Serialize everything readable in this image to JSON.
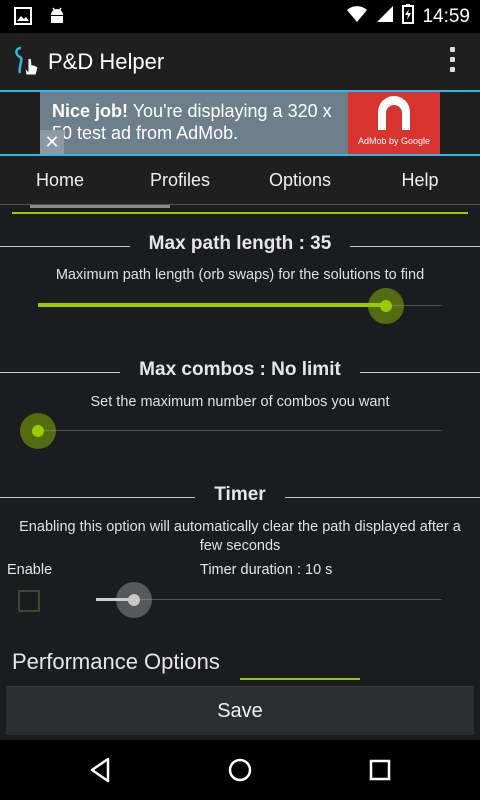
{
  "status_bar": {
    "time": "14:59",
    "left_icons": [
      "image-icon",
      "android-icon"
    ],
    "right_icons": [
      "wifi-icon",
      "signal-icon",
      "battery-icon"
    ]
  },
  "app_bar": {
    "title": "P&D Helper",
    "icon": "app-logo-icon",
    "menu_icon": "overflow-menu-icon"
  },
  "ad": {
    "bold_text": "Nice job!",
    "text": " You're displaying a 320 x 50 test ad from AdMob.",
    "logo_caption": "AdMob by Google",
    "close_symbol": "✕"
  },
  "tabs": [
    {
      "label": "Home"
    },
    {
      "label": "Profiles"
    },
    {
      "label": "Options"
    },
    {
      "label": "Help"
    }
  ],
  "settings": {
    "max_path": {
      "title": "Max path length : 35",
      "description": "Maximum path length (orb swaps) for the solutions to find",
      "value_fraction": 0.87
    },
    "max_combos": {
      "title": "Max combos : No limit",
      "description": "Set the maximum number of combos you want",
      "value_fraction": 0.0
    },
    "timer": {
      "title": "Timer",
      "description": "Enabling this option will automatically clear the path displayed after a few seconds",
      "enable_label": "Enable",
      "enabled": false,
      "duration_label": "Timer duration : 10 s",
      "value_fraction": 0.12
    },
    "performance_title": "Performance Options"
  },
  "save_button": {
    "label": "Save"
  },
  "nav_bar": {
    "icons": [
      "back-icon",
      "home-icon",
      "recents-icon"
    ]
  },
  "colors": {
    "accent_green": "#99cc00",
    "accent_cyan": "#33b5e5",
    "ad_red": "#d8332f"
  }
}
